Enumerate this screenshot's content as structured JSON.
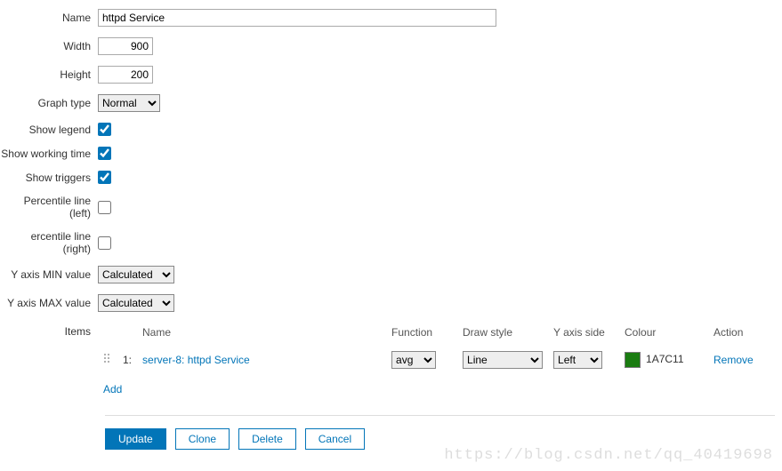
{
  "fields": {
    "name": {
      "label": "Name",
      "value": "httpd Service"
    },
    "width": {
      "label": "Width",
      "value": "900"
    },
    "height": {
      "label": "Height",
      "value": "200"
    },
    "graph_type": {
      "label": "Graph type",
      "value": "Normal"
    },
    "show_legend": {
      "label": "Show legend",
      "checked": true
    },
    "show_working_time": {
      "label": "Show working time",
      "checked": true
    },
    "show_triggers": {
      "label": "Show triggers",
      "checked": true
    },
    "percentile_left": {
      "label": "Percentile line (left)",
      "checked": false
    },
    "percentile_right": {
      "label": "ercentile line (right)",
      "checked": false
    },
    "y_min": {
      "label": "Y axis MIN value",
      "value": "Calculated"
    },
    "y_max": {
      "label": "Y axis MAX value",
      "value": "Calculated"
    }
  },
  "items_section": {
    "label": "Items",
    "headers": {
      "name": "Name",
      "function": "Function",
      "draw_style": "Draw style",
      "y_side": "Y axis side",
      "colour": "Colour",
      "action": "Action"
    },
    "rows": [
      {
        "index": "1:",
        "name": "server-8: httpd Service",
        "function": "avg",
        "draw_style": "Line",
        "y_side": "Left",
        "colour_hex": "1A7C11",
        "colour_css": "#1A7C11",
        "action": "Remove"
      }
    ],
    "add_label": "Add"
  },
  "buttons": {
    "update": "Update",
    "clone": "Clone",
    "delete": "Delete",
    "cancel": "Cancel"
  },
  "watermark": "https://blog.csdn.net/qq_40419698"
}
